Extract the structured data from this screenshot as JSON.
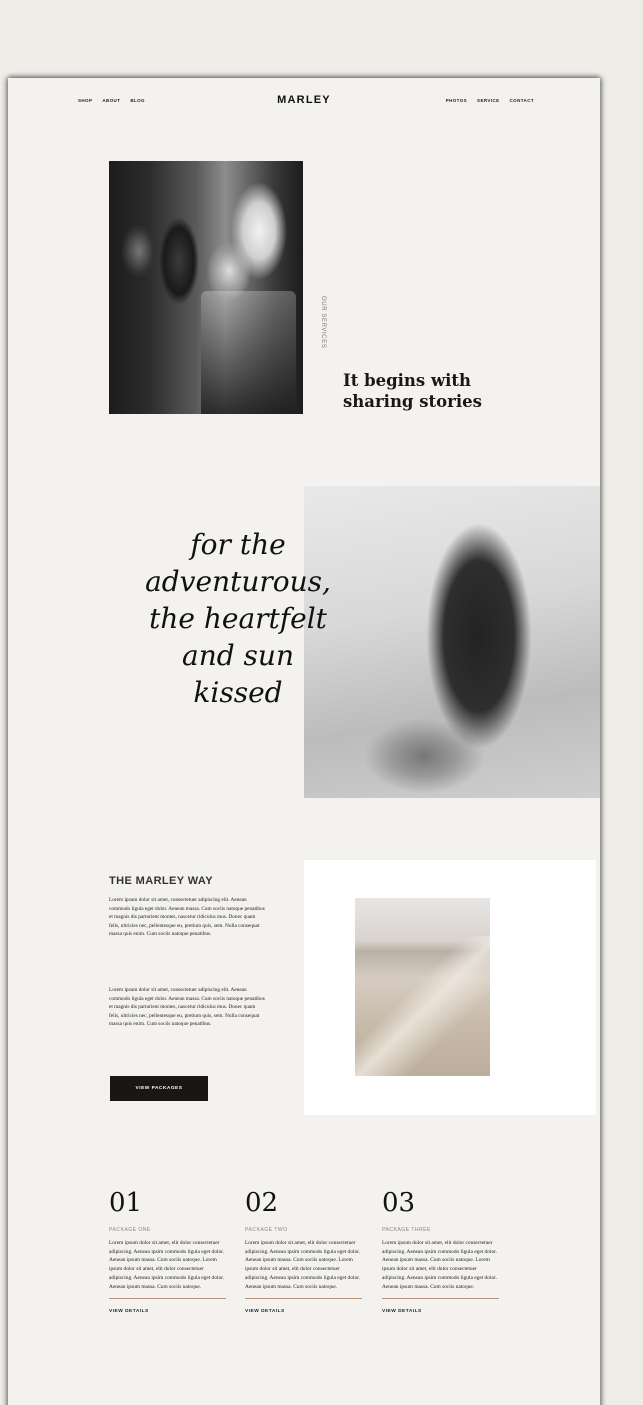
{
  "nav": {
    "left": [
      "SHOP",
      "ABOUT",
      "BLOG"
    ],
    "right": [
      "PHOTOS",
      "SERVICE",
      "CONTACT"
    ],
    "logo": "MARLEY"
  },
  "intro": {
    "vertical_label": "OUR SERVICES",
    "heading_line1": "It begins with",
    "heading_line2": "sharing stories"
  },
  "script": {
    "line1": "for the",
    "line2": "adventurous,",
    "line3": "the heartfelt",
    "line4": "and sun",
    "line5": "kissed"
  },
  "marley_way": {
    "title": "THE MARLEY WAY",
    "paragraph1": "Lorem ipsum dolor sit amet, consectetuer adipiscing elit. Aenean commodo ligula eget dolor. Aenean massa. Cum sociis natoque penatibus et magnis dis parturient montes, nascetur ridiculus mus. Donec quam felis, ultricies nec, pellentesque eu, pretium quis, sem. Nulla consequat massa quis enim. Cum sociis natoque penatibus.",
    "paragraph2": "Lorem ipsum dolor sit amet, consectetuer adipiscing elit. Aenean commodo ligula eget dolor. Aenean massa. Cum sociis natoque penatibus et magnis dis parturient montes, nascetur ridiculus mus. Donec quam felis, ultricies nec, pellentesque eu, pretium quis, sem. Nulla consequat massa quis enim. Cum sociis natoque penatibus.",
    "button": "VIEW PACKAGES"
  },
  "packages": [
    {
      "number": "01",
      "name": "PACKAGE ONE",
      "text": "Lorem ipsum dolor sit amet, elit dolor consectetuer adipiscing. Aenean ipsim commodo ligula eget dolor. Aenean ipsum massa. Cum sociis natoque. Lorem ipsum dolor sit amet, elit dolor consectetuer adipiscing. Aenean ipsim commodo ligula eget dolor. Aenean ipsum massa. Cum sociis natoque.",
      "link": "VIEW DETAILS"
    },
    {
      "number": "02",
      "name": "PACKAGE TWO",
      "text": "Lorem ipsum dolor sit amet, elit dolor consectetuer adipiscing. Aenean ipsim commodo ligula eget dolor. Aenean ipsum massa. Cum sociis natoque. Lorem ipsum dolor sit amet, elit dolor consectetuer adipiscing. Aenean ipsim commodo ligula eget dolor. Aenean ipsum massa. Cum sociis natoque.",
      "link": "VIEW DETAILS"
    },
    {
      "number": "03",
      "name": "PACKAGE THREE",
      "text": "Lorem ipsum dolor sit amet, elit dolor consectetuer adipiscing. Aenean ipsim commodo ligula eget dolor. Aenean ipsum massa. Cum sociis natoque. Lorem ipsum dolor sit amet, elit dolor consectetuer adipiscing. Aenean ipsim commodo ligula eget dolor. Aenean ipsum massa. Cum sociis natoque.",
      "link": "VIEW DETAILS"
    }
  ]
}
